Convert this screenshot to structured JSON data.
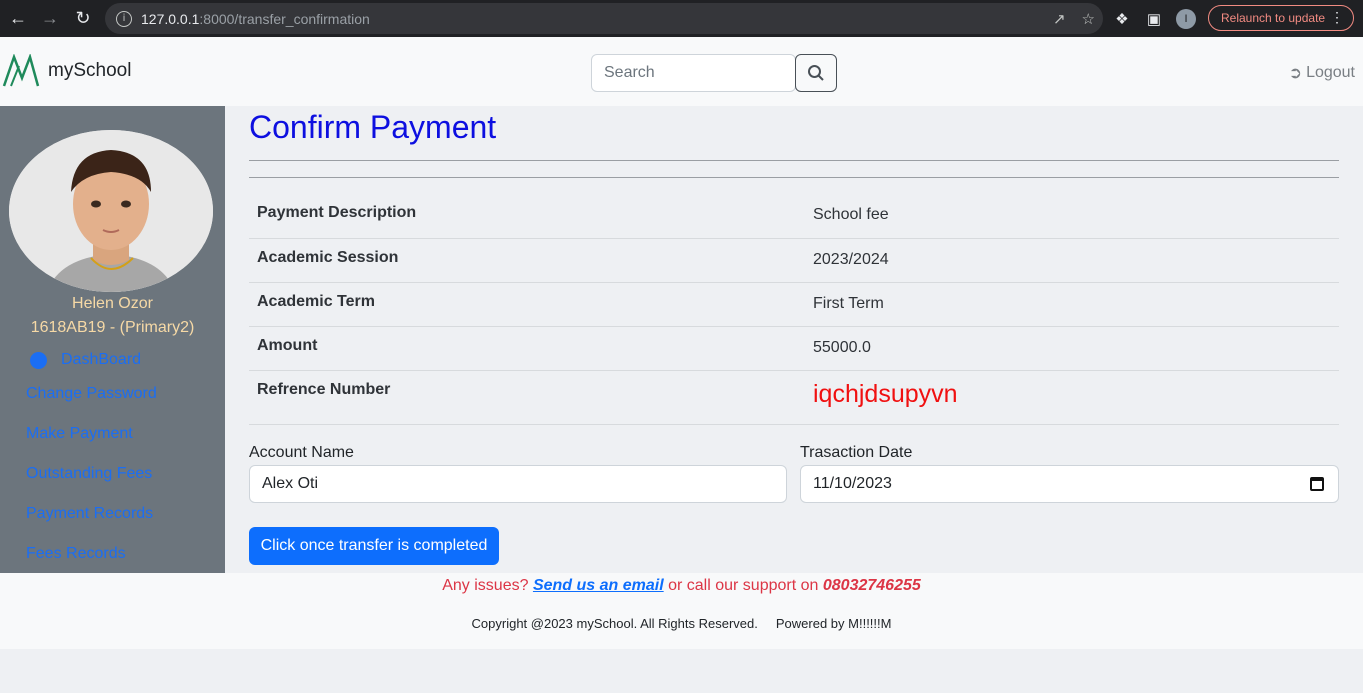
{
  "browser": {
    "url_host": "127.0.0.1",
    "url_rest": ":8000/transfer_confirmation",
    "relaunch_label": "Relaunch to update",
    "profile_initial": "I"
  },
  "navbar": {
    "brand": "mySchool",
    "search_placeholder": "Search",
    "logout_label": "Logout"
  },
  "sidebar": {
    "student_name": "Helen Ozor",
    "student_id": "1618AB19 - (Primary2)",
    "links": [
      {
        "label": "DashBoard"
      },
      {
        "label": "Change Password"
      },
      {
        "label": "Make Payment"
      },
      {
        "label": "Outstanding Fees"
      },
      {
        "label": "Payment Records"
      },
      {
        "label": "Fees Records"
      }
    ]
  },
  "main": {
    "title": "Confirm Payment",
    "details": [
      {
        "label": "Payment Description",
        "value": "School fee"
      },
      {
        "label": "Academic Session",
        "value": "2023/2024"
      },
      {
        "label": "Academic Term",
        "value": "First Term"
      },
      {
        "label": "Amount",
        "value": "55000.0"
      },
      {
        "label": "Refrence Number",
        "value": "iqchjdsupyvn"
      }
    ],
    "account_name_label": "Account Name",
    "account_name_value": "Alex Oti",
    "transaction_date_label": "Trasaction Date",
    "transaction_date_value": "11/10/2023",
    "submit_label": "Click once transfer is completed"
  },
  "footer": {
    "issues_prefix": "Any issues?",
    "email_link": "Send us an email",
    "issues_middle": "or call our support on",
    "phone": "08032746255",
    "copyright": "Copyright @2023 mySchool. All Rights Reserved.",
    "powered": "Powered by M!!!!!!M"
  },
  "colors": {
    "title": "#0d0fe0",
    "reference": "#f01010",
    "sidebar_bg": "#6c757d",
    "link": "#1b6ef3",
    "button": "#0d6efd"
  }
}
